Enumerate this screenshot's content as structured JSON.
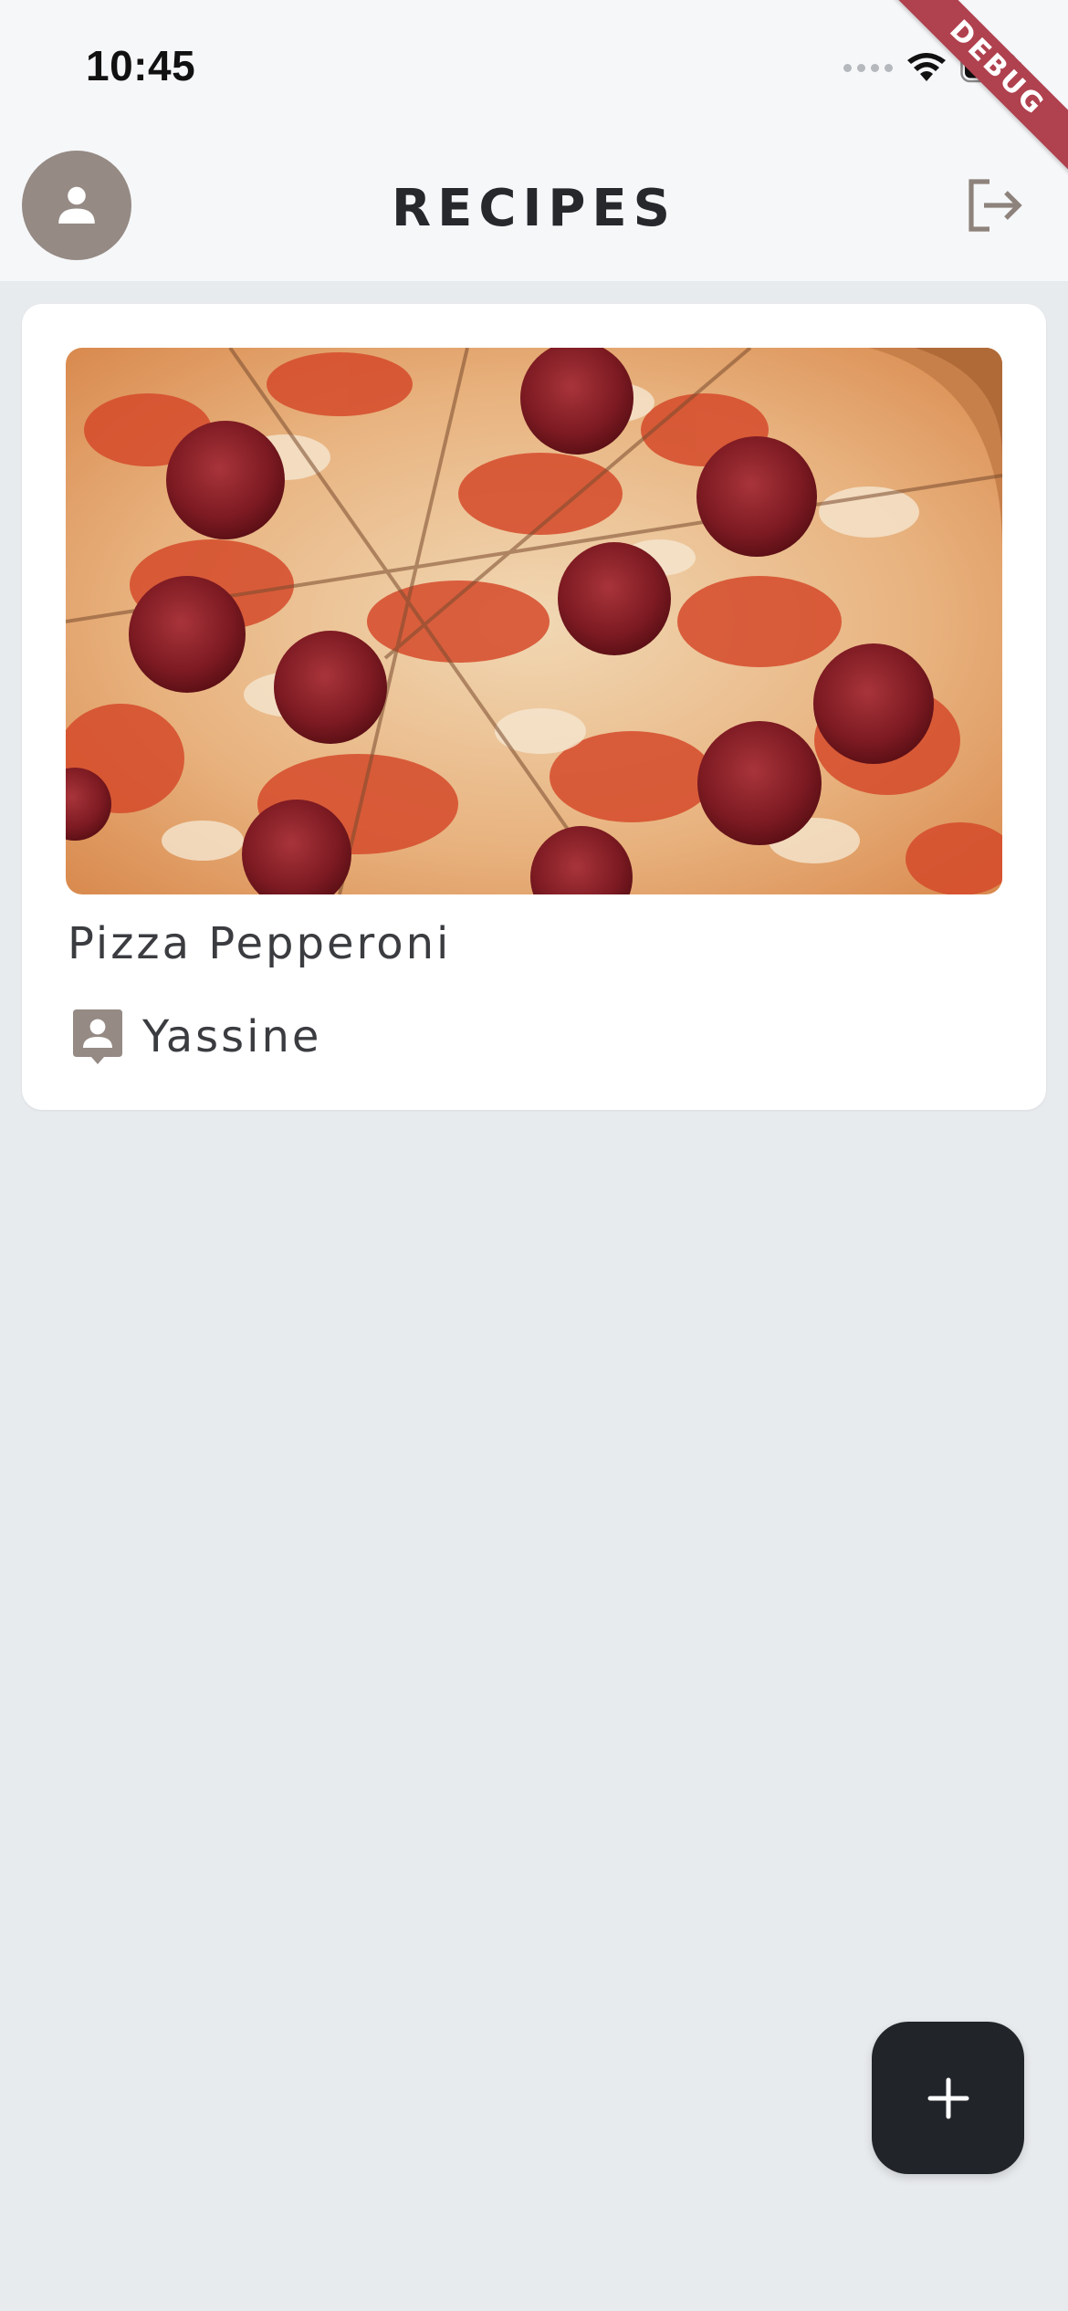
{
  "status_bar": {
    "time": "10:45",
    "icons": [
      "signal-icon",
      "wifi-icon",
      "battery-icon"
    ]
  },
  "debug_banner": {
    "label": "DEBUG",
    "color": "#b0414e"
  },
  "app_bar": {
    "title": "RECIPES",
    "avatar_icon": "person-icon",
    "logout_icon": "logout-icon"
  },
  "recipes": [
    {
      "title": "Pizza Pepperoni",
      "author": "Yassine",
      "author_icon": "contact-icon"
    }
  ],
  "fab": {
    "icon": "plus-icon"
  },
  "colors": {
    "background": "#e8ebee",
    "app_bar": "#f6f7f9",
    "card": "#ffffff",
    "accent": "#958a84",
    "fab": "#212428",
    "text": "#2b2d31"
  }
}
